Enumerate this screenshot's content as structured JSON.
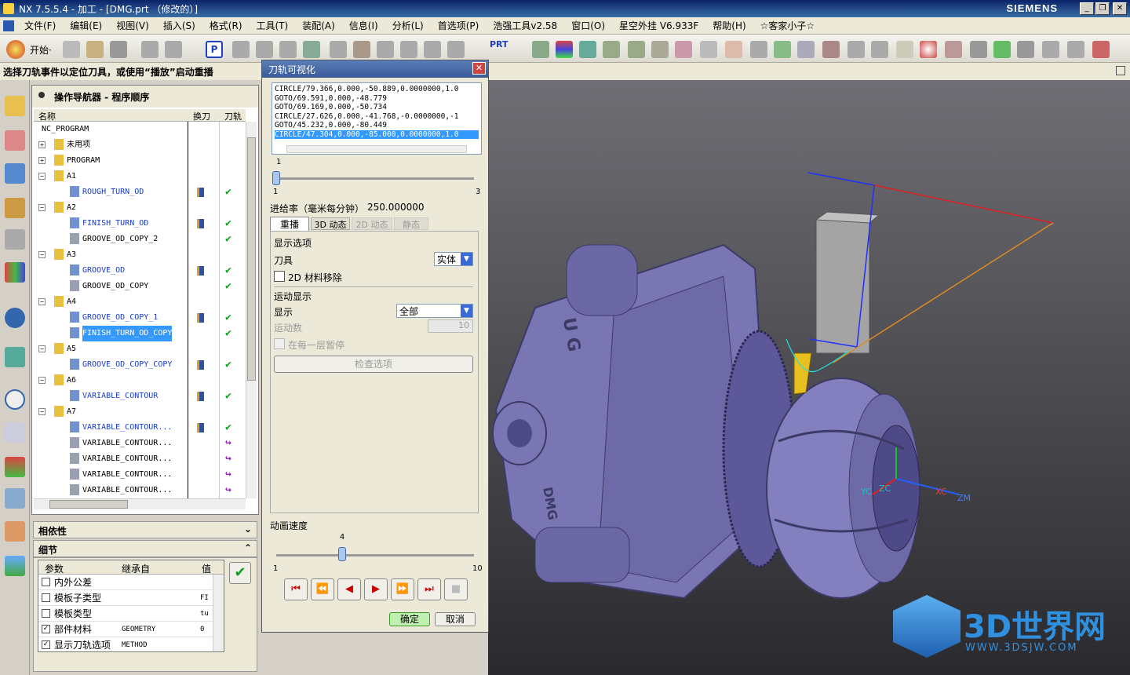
{
  "window": {
    "title": "NX 7.5.5.4 - 加工 - [DMG.prt （修改的）]",
    "brand": "SIEMENS"
  },
  "menu": [
    "文件(F)",
    "编辑(E)",
    "视图(V)",
    "插入(S)",
    "格式(R)",
    "工具(T)",
    "装配(A)",
    "信息(I)",
    "分析(L)",
    "首选项(P)",
    "浩强工具v2.58",
    "窗口(O)",
    "星空外挂 V6.933F",
    "帮助(H)",
    "☆客家小子☆"
  ],
  "toolbar": {
    "start_label": "开始·",
    "prt_label": "PRT"
  },
  "hint": "选择刀轨事件以定位刀具，或使用“播放”启动重播",
  "navigator": {
    "title": "操作导航器 - 程序顺序",
    "columns": [
      "名称",
      "换刀",
      "刀轨"
    ],
    "rows": [
      {
        "name": "NC_PROGRAM",
        "level": 0,
        "type": "root"
      },
      {
        "name": "未用项",
        "level": 1,
        "type": "group"
      },
      {
        "name": "PROGRAM",
        "level": 1,
        "type": "group"
      },
      {
        "name": "A1",
        "level": 1,
        "type": "group"
      },
      {
        "name": "ROUGH_TURN_OD",
        "level": 2,
        "type": "op",
        "tool": true,
        "status": "✔"
      },
      {
        "name": "A2",
        "level": 1,
        "type": "group"
      },
      {
        "name": "FINISH_TURN_OD",
        "level": 2,
        "type": "op",
        "tool": true,
        "status": "✔"
      },
      {
        "name": "GROOVE_OD_COPY_2",
        "level": 2,
        "type": "op2",
        "tool": false,
        "status": "✔"
      },
      {
        "name": "A3",
        "level": 1,
        "type": "group"
      },
      {
        "name": "GROOVE_OD",
        "level": 2,
        "type": "op",
        "tool": true,
        "status": "✔"
      },
      {
        "name": "GROOVE_OD_COPY",
        "level": 2,
        "type": "op2",
        "tool": false,
        "status": "✔"
      },
      {
        "name": "A4",
        "level": 1,
        "type": "group"
      },
      {
        "name": "GROOVE_OD_COPY_1",
        "level": 2,
        "type": "op",
        "tool": true,
        "status": "✔"
      },
      {
        "name": "FINISH_TURN_OD_COPY",
        "level": 2,
        "type": "op",
        "tool": false,
        "status": "✔",
        "selected": true
      },
      {
        "name": "A5",
        "level": 1,
        "type": "group"
      },
      {
        "name": "GROOVE_OD_COPY_COPY",
        "level": 2,
        "type": "op",
        "tool": true,
        "status": "✔"
      },
      {
        "name": "A6",
        "level": 1,
        "type": "group"
      },
      {
        "name": "VARIABLE_CONTOUR",
        "level": 2,
        "type": "op",
        "tool": true,
        "status": "✔"
      },
      {
        "name": "A7",
        "level": 1,
        "type": "group"
      },
      {
        "name": "VARIABLE_CONTOUR...",
        "level": 2,
        "type": "op",
        "tool": true,
        "status": "✔"
      },
      {
        "name": "VARIABLE_CONTOUR...",
        "level": 2,
        "type": "op2",
        "tool": false,
        "status": "↪"
      },
      {
        "name": "VARIABLE_CONTOUR...",
        "level": 2,
        "type": "op2",
        "tool": false,
        "status": "↪"
      },
      {
        "name": "VARIABLE_CONTOUR...",
        "level": 2,
        "type": "op2",
        "tool": false,
        "status": "↪"
      },
      {
        "name": "VARIABLE_CONTOUR...",
        "level": 2,
        "type": "op2",
        "tool": false,
        "status": "↪"
      }
    ]
  },
  "panels": {
    "dependency": "相依性",
    "details": "细节"
  },
  "params": {
    "columns": [
      "参数",
      "继承自",
      "值"
    ],
    "rows": [
      {
        "name": "内外公差",
        "from": "",
        "value": "",
        "checked": false
      },
      {
        "name": "模板子类型",
        "from": "",
        "value": "FI",
        "checked": false
      },
      {
        "name": "模板类型",
        "from": "",
        "value": "tu",
        "checked": false
      },
      {
        "name": "部件材料",
        "from": "GEOMETRY",
        "value": "0",
        "checked": true
      },
      {
        "name": "显示刀轨选项",
        "from": "METHOD",
        "value": "",
        "checked": true
      }
    ]
  },
  "dialog": {
    "title": "刀轨可视化",
    "code_lines": [
      "CIRCLE/79.366,0.000,-50.889,0.0000000,1.0",
      "GOTO/69.591,0.000,-48.779",
      "GOTO/69.169,0.000,-50.734",
      "CIRCLE/27.626,0.000,-41.768,-0.0000000,-1",
      "GOTO/45.232,0.000,-80.449",
      "CIRCLE/47.304,0.000,-85.000,0.0000000,1.0"
    ],
    "slider1": {
      "value": "1",
      "min": "1",
      "max": "3",
      "fraction": 0.0
    },
    "feed_label": "进给率（毫米每分钟）",
    "feed_value": "250.000000",
    "tabs": [
      "重播",
      "3D 动态",
      "2D 动态",
      "静态"
    ],
    "display_options": "显示选项",
    "tool_label": "刀具",
    "tool_value": "实体",
    "material_removal": "2D 材料移除",
    "motion_display": "运动显示",
    "show_label": "显示",
    "show_value": "全部",
    "motion_count_label": "运动数",
    "motion_count_value": "10",
    "pause_each_layer": "在每一层暂停",
    "check_options": "检查选项",
    "anim_speed_label": "动画速度",
    "speed": {
      "value": "4",
      "min": "1",
      "max": "10",
      "fraction": 0.333
    },
    "ok": "确定",
    "cancel": "取消"
  },
  "viewport": {
    "axes": [
      "YC",
      "ZC",
      "XC",
      "ZM"
    ],
    "body_text": "U G",
    "body_text2": "DMG",
    "watermark": "3D世界网",
    "watermark_url": "WWW.3DSJW.COM"
  }
}
